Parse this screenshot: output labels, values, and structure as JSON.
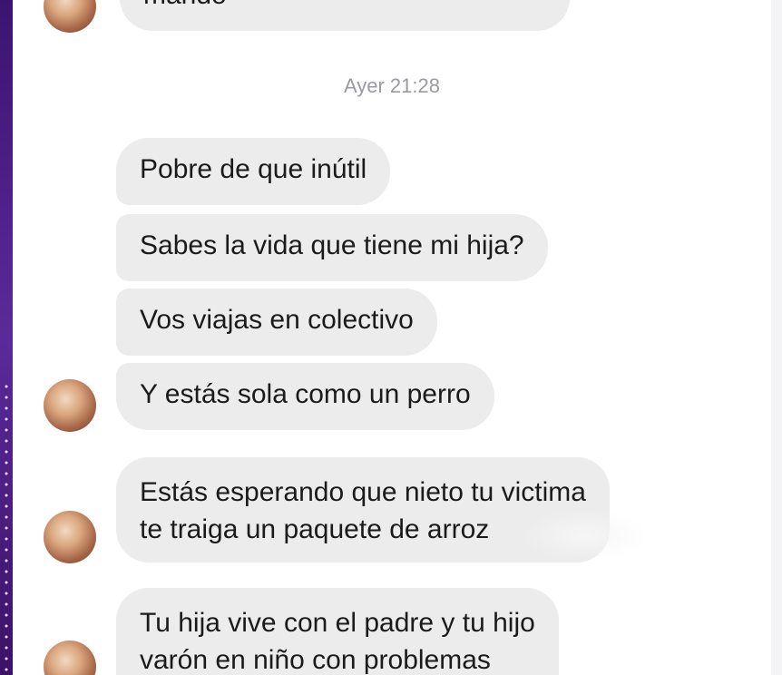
{
  "chat": {
    "timestamp": "Ayer 21:28",
    "partial_top_text": "mando",
    "messages": [
      {
        "lines": [
          "Pobre de que inútil"
        ]
      },
      {
        "lines": [
          "Sabes la vida que tiene mi hija?"
        ]
      },
      {
        "lines": [
          "Vos viajas en colectivo"
        ]
      },
      {
        "lines": [
          "Y estás sola como un perro"
        ]
      },
      {
        "lines": [
          "Estás esperando que nieto tu victima",
          "te traiga un paquete de arroz"
        ]
      },
      {
        "lines": [
          "Tu hija vive con el padre y tu hijo",
          "varón en niño con problemas"
        ]
      }
    ]
  },
  "colors": {
    "bubble_bg": "#ececec",
    "text": "#1b1b1b",
    "timestamp": "#9a9aa0",
    "side_strip": "#4a1f86"
  },
  "icons": {
    "avatar": "contact-avatar-photo"
  }
}
